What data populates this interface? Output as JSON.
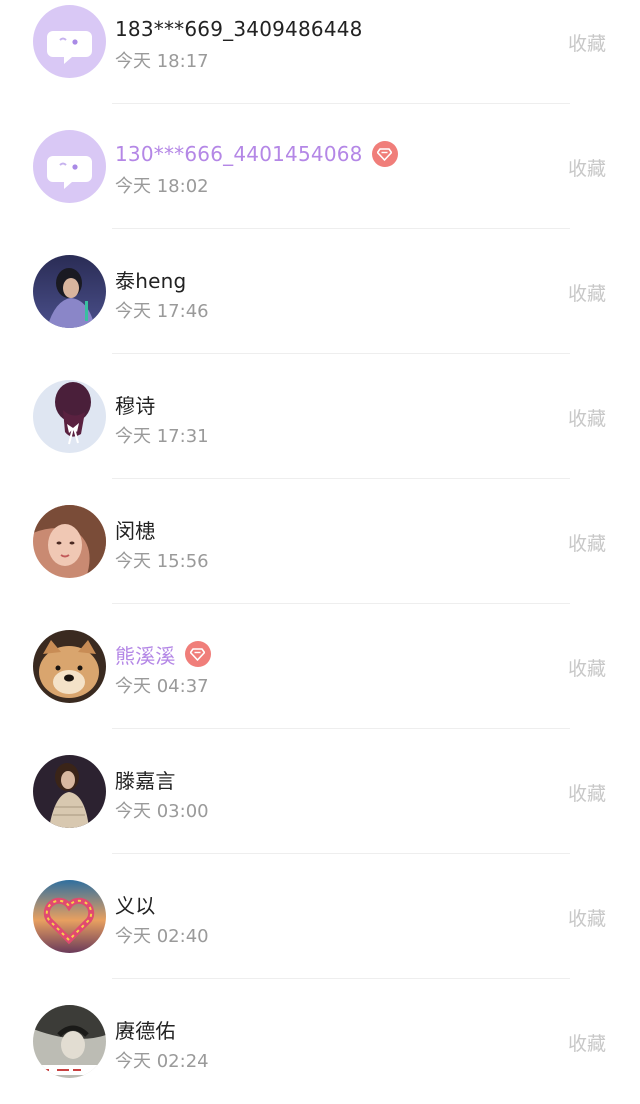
{
  "records": [
    {
      "name": "183***669_3409486448",
      "time": "今天 18:17",
      "vip": false,
      "avatar": "default-chat-avatar",
      "action": "收藏"
    },
    {
      "name": "130***666_4401454068",
      "time": "今天 18:02",
      "vip": true,
      "avatar": "default-chat-avatar",
      "action": "收藏"
    },
    {
      "name": "泰heng",
      "time": "今天 17:46",
      "vip": false,
      "avatar": "photo-person-purple",
      "action": "收藏"
    },
    {
      "name": "穆诗",
      "time": "今天 17:31",
      "vip": false,
      "avatar": "photo-hair-bow",
      "action": "收藏"
    },
    {
      "name": "闵槵",
      "time": "今天 15:56",
      "vip": false,
      "avatar": "photo-face-warm",
      "action": "收藏"
    },
    {
      "name": "熊溪溪",
      "time": "今天 04:37",
      "vip": true,
      "avatar": "photo-dog",
      "action": "收藏"
    },
    {
      "name": "滕嘉言",
      "time": "今天 03:00",
      "vip": false,
      "avatar": "photo-woman-dark",
      "action": "收藏"
    },
    {
      "name": "义以",
      "time": "今天 02:40",
      "vip": false,
      "avatar": "photo-heart-sunset",
      "action": "收藏"
    },
    {
      "name": "赓德佑",
      "time": "今天 02:24",
      "vip": false,
      "avatar": "photo-monochrome",
      "action": "收藏"
    }
  ],
  "colors": {
    "vip_name": "#b487e6",
    "vip_badge": "#f07e7a",
    "name": "#222222",
    "time": "#9a9a9a",
    "action": "#c8c8c8",
    "default_avatar_bg": "#d9c8f5"
  }
}
